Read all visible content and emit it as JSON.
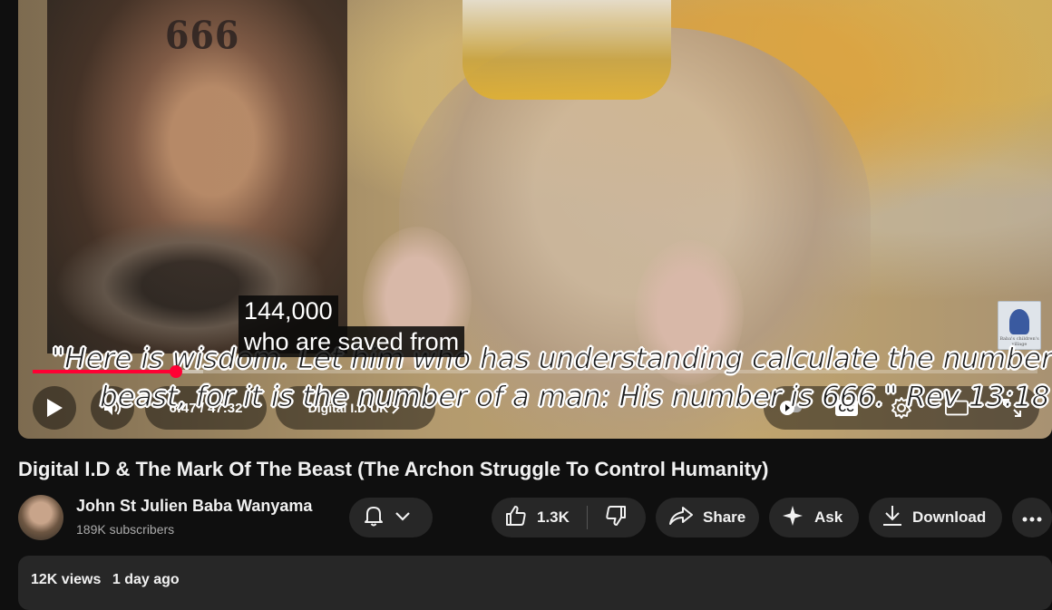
{
  "player": {
    "overlay_text_666": "666",
    "burned_verse_line1": "\"Here is wisdom. Let him who has understanding calculate the number of the",
    "burned_verse_line2": "beast, for it is the number of a man: His number is 666.\" Rev 13:18",
    "caption_line1": "144,000",
    "caption_line2": "who are saved from",
    "time_display": "6:47 / 47:32",
    "chapter_label": "Digital I.D UK",
    "progress_fraction": 0.143,
    "buffer_fraction": 0.17,
    "cc_label": "CC",
    "accent_color": "#ff0033"
  },
  "video": {
    "title": "Digital I.D & The Mark Of The Beast (The Archon Struggle To Control Humanity)"
  },
  "channel": {
    "name": "John St Julien Baba Wanyama",
    "subscribers": "189K subscribers"
  },
  "actions": {
    "like_count": "1.3K",
    "share_label": "Share",
    "ask_label": "Ask",
    "download_label": "Download"
  },
  "description": {
    "views": "12K views",
    "age": "1 day ago"
  },
  "icons": [
    "play-icon",
    "volume-icon",
    "chevron-right-icon",
    "autoplay-icon",
    "cc-icon",
    "settings-icon",
    "theater-icon",
    "fullscreen-icon",
    "bell-icon",
    "chevron-down-icon",
    "thumbs-up-icon",
    "thumbs-down-icon",
    "share-icon",
    "sparkle-icon",
    "download-icon",
    "more-icon"
  ]
}
